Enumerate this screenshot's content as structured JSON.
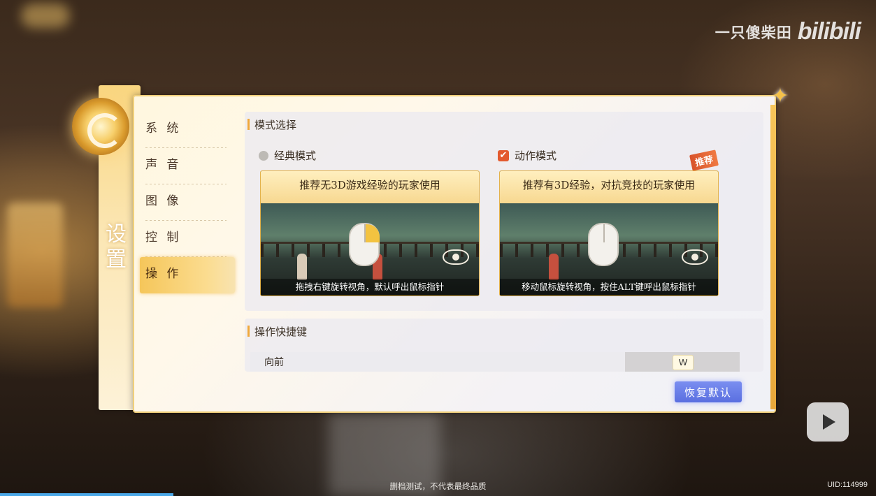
{
  "watermark": {
    "user": "一只傻柴田",
    "logo": "bilibili"
  },
  "sidebar": {
    "title": "设置",
    "items": [
      {
        "label": "系 统"
      },
      {
        "label": "声 音"
      },
      {
        "label": "图 像"
      },
      {
        "label": "控 制"
      },
      {
        "label": "操 作"
      }
    ],
    "active_index": 4
  },
  "mode_section": {
    "title": "模式选择",
    "classic": {
      "label": "经典模式",
      "selected": false,
      "header": "推荐无3D游戏经验的玩家使用",
      "footer": "拖拽右键旋转视角，默认呼出鼠标指针"
    },
    "action": {
      "label": "动作模式",
      "selected": true,
      "badge": "推荐",
      "header": "推荐有3D经验，对抗竞技的玩家使用",
      "footer": "移动鼠标旋转视角，按住ALT键呼出鼠标指针"
    }
  },
  "shortcut_section": {
    "title": "操作快捷键",
    "rows": [
      {
        "action": "向前",
        "key": "W"
      }
    ]
  },
  "reset_label": "恢复默认",
  "footer_note": "删档测试，不代表最终品质",
  "uid": "UID:114999",
  "colors": {
    "accent": "#f0a83a",
    "check": "#e35a2e",
    "reset": "#5a6fe0"
  }
}
